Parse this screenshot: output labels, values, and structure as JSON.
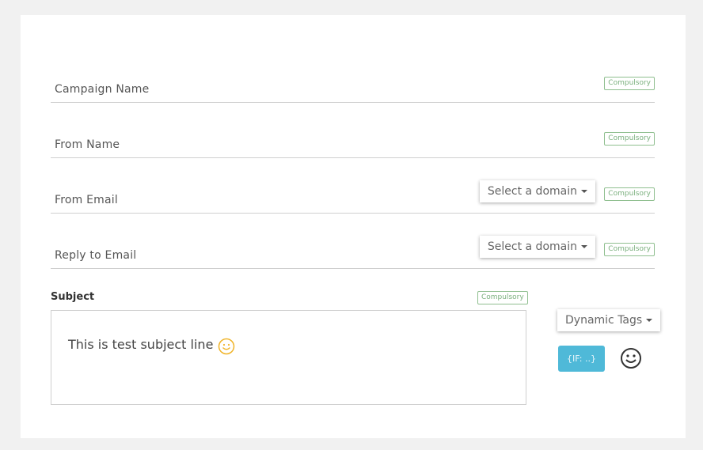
{
  "form": {
    "fields": [
      {
        "label": "Campaign Name",
        "badge": "Compulsory"
      },
      {
        "label": "From Name",
        "badge": "Compulsory"
      },
      {
        "label": "From Email",
        "badge": "Compulsory",
        "domain_select": "Select a domain"
      },
      {
        "label": "Reply to Email",
        "badge": "Compulsory",
        "domain_select": "Select a domain"
      }
    ],
    "subject": {
      "label": "Subject",
      "badge": "Compulsory",
      "value": "This is test subject line",
      "inline_icon": "smiley-icon"
    },
    "dynamic_tags_label": "Dynamic Tags",
    "if_button_label": "{IF: ..}",
    "emoji_button_icon": "smiley-icon"
  },
  "colors": {
    "background": "#f1f1f1",
    "badge_green": "#7bb07e",
    "if_button": "#4fb9d8",
    "smiley_yellow": "#f0b429"
  }
}
